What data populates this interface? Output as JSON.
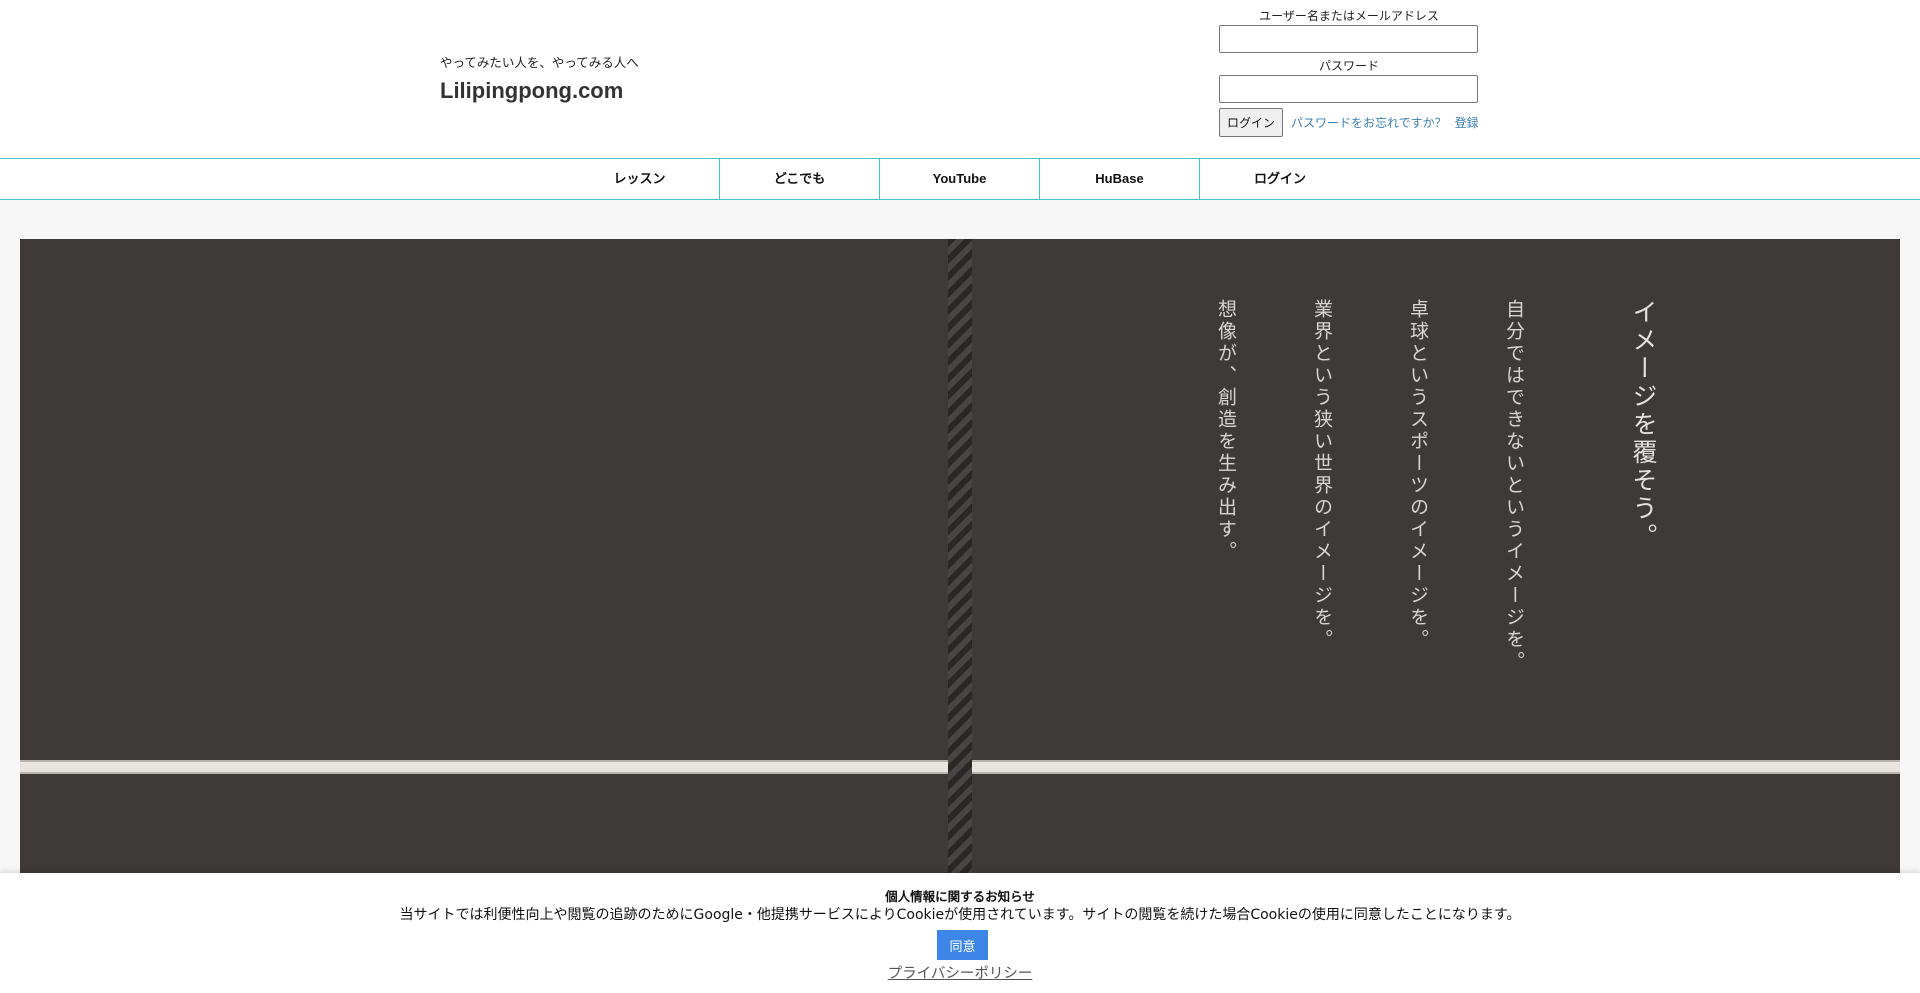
{
  "header": {
    "tagline": "やってみたい人を、やってみる人へ",
    "site_title": "Lilipingpong.com"
  },
  "login": {
    "username_label": "ユーザー名またはメールアドレス",
    "username_value": "",
    "password_label": "パスワード",
    "password_value": "",
    "login_button": "ログイン",
    "forgot_link": "パスワードをお忘れですか？",
    "register_link": "登録"
  },
  "nav": {
    "items": [
      {
        "label": "レッスン"
      },
      {
        "label": "どこでも"
      },
      {
        "label": "YouTube"
      },
      {
        "label": "HuBase"
      },
      {
        "label": "ログイン"
      }
    ]
  },
  "hero": {
    "lines": [
      "イメージを覆そう。",
      "自分ではできないというイメージを。",
      "卓球というスポーツのイメージを。",
      "業界という狭い世界のイメージを。",
      "想像が、創造を生み出す。"
    ]
  },
  "cookie": {
    "title": "個人情報に関するお知らせ",
    "text": "当サイトでは利便性向上や閲覧の追跡のためにGoogle・他提携サービスによりCookieが使用されています。サイトの閲覧を続けた場合Cookieの使用に同意したことになります。",
    "agree_button": "同意",
    "policy_link": "プライバシーポリシー"
  },
  "colors": {
    "nav_border": "#3ec4c8",
    "hero_bg": "#3e3a3a",
    "link": "#3b7fb5",
    "agree_button": "#3d86e8"
  }
}
